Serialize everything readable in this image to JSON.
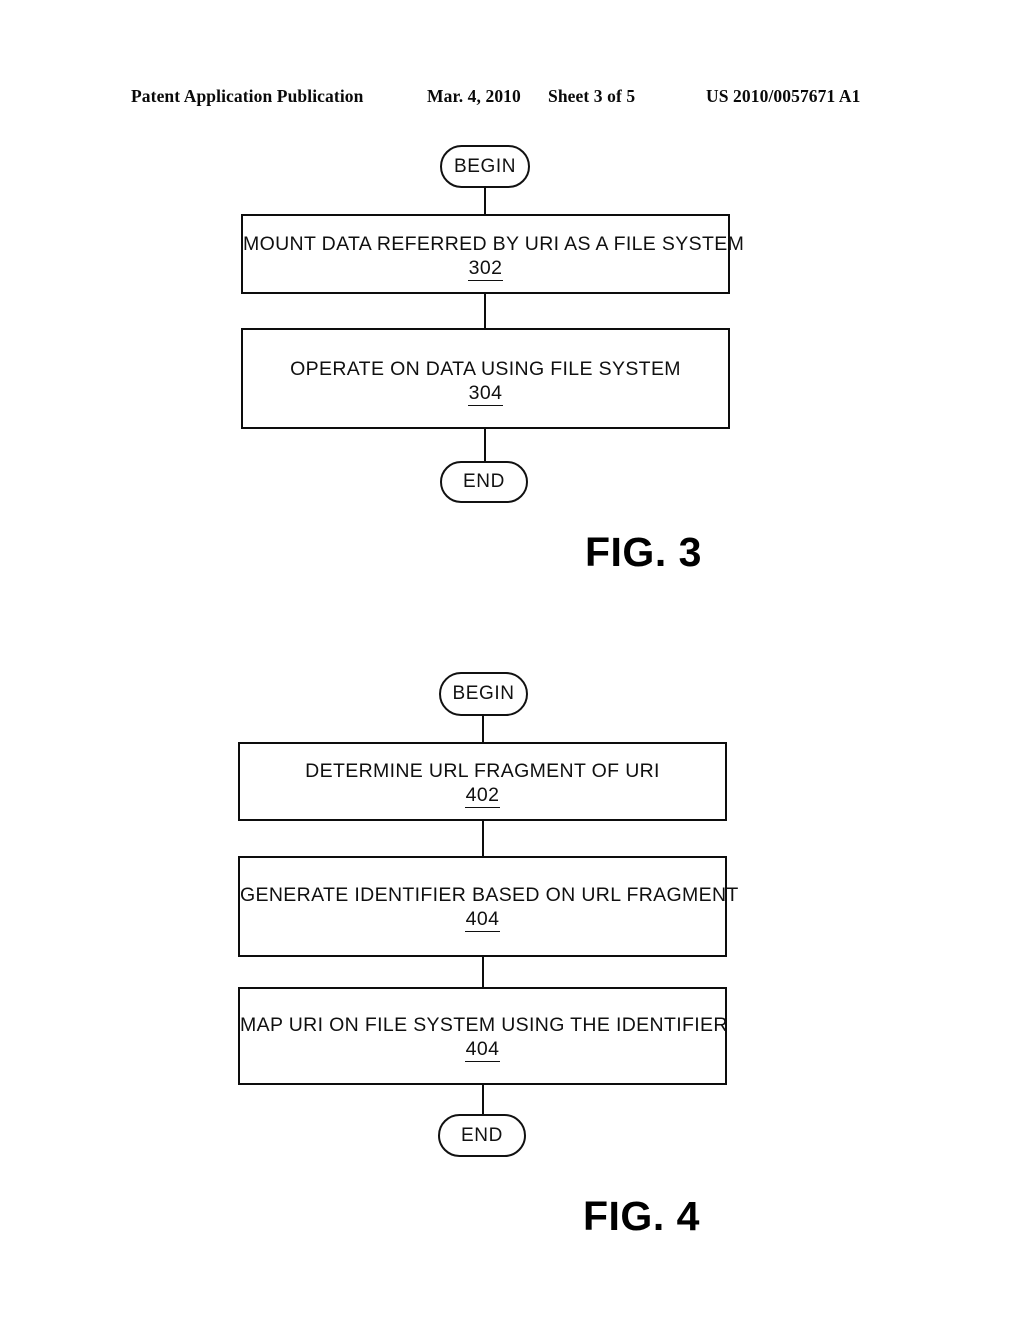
{
  "header": {
    "publication": "Patent Application Publication",
    "date": "Mar. 4, 2010",
    "sheet": "Sheet 3 of 5",
    "patent_number": "US 2010/0057671 A1"
  },
  "figures": [
    {
      "id": "fig3",
      "label": "FIG. 3",
      "start_label": "BEGIN",
      "end_label": "END",
      "steps": [
        {
          "text": "MOUNT DATA REFERRED BY URI AS A FILE SYSTEM",
          "number": "302"
        },
        {
          "text": "OPERATE ON DATA USING FILE SYSTEM",
          "number": "304"
        }
      ]
    },
    {
      "id": "fig4",
      "label": "FIG. 4",
      "start_label": "BEGIN",
      "end_label": "END",
      "steps": [
        {
          "text": "DETERMINE URL FRAGMENT OF URI",
          "number": "402"
        },
        {
          "text": "GENERATE IDENTIFIER BASED ON URL FRAGMENT",
          "number": "404"
        },
        {
          "text": "MAP URI ON FILE SYSTEM USING THE IDENTIFIER",
          "number": "404"
        }
      ]
    }
  ],
  "colors": {
    "ink": "#0d0d0d",
    "page": "#ffffff"
  }
}
